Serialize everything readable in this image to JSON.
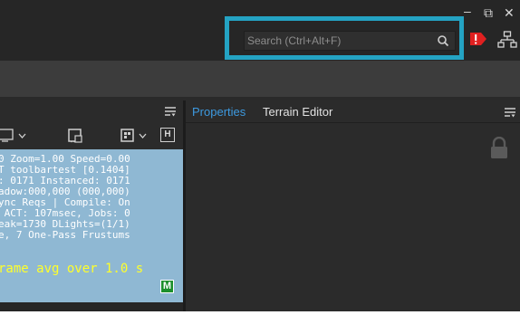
{
  "window_controls": {
    "minimize": "–",
    "restore": "⧉",
    "close": "✕"
  },
  "search": {
    "placeholder": "Search (Ctrl+Alt+F)"
  },
  "viewport": {
    "stats_lines": [
      "0 Zoom=1.00 Speed=0.00",
      "T toolbartest [0.1404]",
      ": 0171 Instanced: 0171",
      "adow:000,000 (000,000)",
      "ync Reqs | Compile: On",
      " ACT: 107msec, Jobs: 0",
      "eak=1730 DLights=(1/1)",
      "e, 7 One-Pass Frustums"
    ],
    "frame_avg": "rame avg over 1.0 s",
    "badge": "M",
    "toolbar_badge": "H"
  },
  "properties": {
    "tabs": [
      {
        "label": "Properties",
        "active": true
      },
      {
        "label": "Terrain Editor",
        "active": false
      }
    ]
  },
  "colors": {
    "highlight": "#24a3c3",
    "active_tab": "#3d9ae0",
    "viewport_bg": "#8fb8d3",
    "stats_yellow": "#ffff2a",
    "alert_red": "#e02020"
  }
}
